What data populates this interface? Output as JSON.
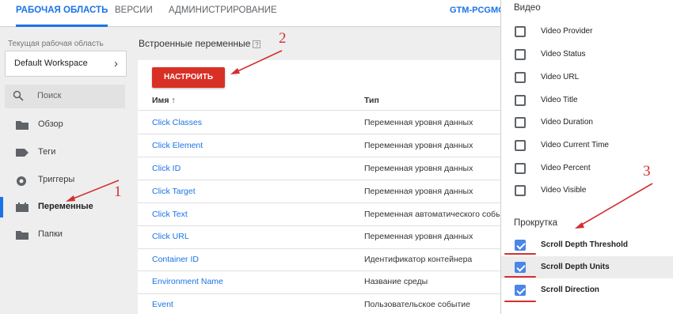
{
  "topnav": {
    "tabs": [
      "Рабочая область",
      "Версии",
      "Администрирование"
    ],
    "account": "GTM-PCGMOLL"
  },
  "sidebar": {
    "workspace_label": "Текущая рабочая область",
    "workspace_value": "Default Workspace",
    "search_placeholder": "Поиск",
    "items": [
      {
        "label": "Обзор",
        "icon": "folder-icon"
      },
      {
        "label": "Теги",
        "icon": "tag-icon"
      },
      {
        "label": "Триггеры",
        "icon": "trigger-icon"
      },
      {
        "label": "Переменные",
        "icon": "variables-icon",
        "active": true
      },
      {
        "label": "Папки",
        "icon": "folder-icon"
      }
    ]
  },
  "main": {
    "title": "Встроенные переменные",
    "help": "?",
    "configure_button": "НАСТРОИТЬ",
    "col_name": "Имя",
    "col_type": "Тип",
    "sort_icon": "↑",
    "rows": [
      {
        "name": "Click Classes",
        "type": "Переменная уровня данных"
      },
      {
        "name": "Click Element",
        "type": "Переменная уровня данных"
      },
      {
        "name": "Click ID",
        "type": "Переменная уровня данных"
      },
      {
        "name": "Click Target",
        "type": "Переменная уровня данных"
      },
      {
        "name": "Click Text",
        "type": "Переменная автоматического события"
      },
      {
        "name": "Click URL",
        "type": "Переменная уровня данных"
      },
      {
        "name": "Container ID",
        "type": "Идентификатор контейнера"
      },
      {
        "name": "Environment Name",
        "type": "Название среды"
      },
      {
        "name": "Event",
        "type": "Пользовательское событие"
      }
    ]
  },
  "panel": {
    "video_title": "Видео",
    "video_items": [
      {
        "label": "Video Provider",
        "checked": false
      },
      {
        "label": "Video Status",
        "checked": false
      },
      {
        "label": "Video URL",
        "checked": false
      },
      {
        "label": "Video Title",
        "checked": false
      },
      {
        "label": "Video Duration",
        "checked": false
      },
      {
        "label": "Video Current Time",
        "checked": false
      },
      {
        "label": "Video Percent",
        "checked": false
      },
      {
        "label": "Video Visible",
        "checked": false
      }
    ],
    "scroll_title": "Прокрутка",
    "scroll_items": [
      {
        "label": "Scroll Depth Threshold",
        "checked": true
      },
      {
        "label": "Scroll Depth Units",
        "checked": true
      },
      {
        "label": "Scroll Direction",
        "checked": true
      }
    ]
  },
  "annotations": [
    "1",
    "2",
    "3"
  ],
  "colors": {
    "accent": "#1a73e8",
    "button_red": "#d93025",
    "annotation_red": "#d32f2f",
    "checkbox_blue": "#4a86e8"
  }
}
